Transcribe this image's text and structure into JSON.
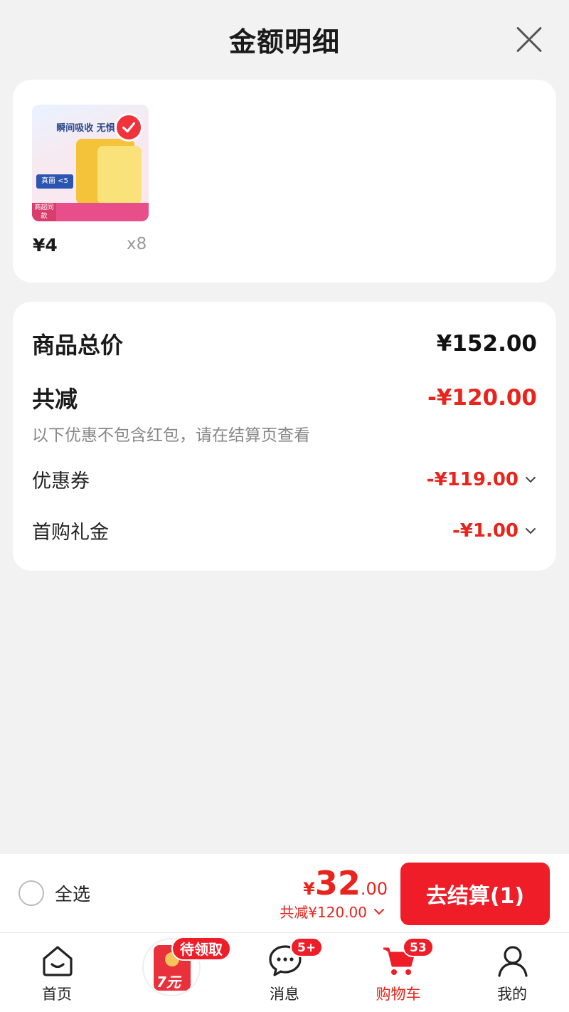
{
  "header": {
    "title": "金额明细"
  },
  "product": {
    "thumb_headline": "瞬间吸收 无惧潮",
    "thumb_tag": "真菌 <5",
    "thumb_badge": "商超同款",
    "price": "¥4",
    "quantity": "x8",
    "selected": true
  },
  "summary": {
    "total_label": "商品总价",
    "total_value": "¥152.00",
    "discount_label": "共减",
    "discount_value": "-¥120.00",
    "note": "以下优惠不包含红包，请在结算页查看",
    "items": [
      {
        "label": "优惠券",
        "value": "-¥119.00"
      },
      {
        "label": "首购礼金",
        "value": "-¥1.00"
      }
    ]
  },
  "checkout": {
    "select_all_label": "全选",
    "price_symbol": "¥",
    "price_integer": "32",
    "price_decimal": ".00",
    "saved_text": "共减¥120.00",
    "button_label": "去结算(1)"
  },
  "tabbar": {
    "promo_pill": "待领取",
    "promo_amount": "7元",
    "items": [
      {
        "label": "首页",
        "icon": "home-icon",
        "badge": ""
      },
      {
        "label": "消息",
        "icon": "message-icon",
        "badge": "5+"
      },
      {
        "label": "购物车",
        "icon": "cart-icon",
        "badge": "53",
        "active": true
      },
      {
        "label": "我的",
        "icon": "profile-icon",
        "badge": ""
      }
    ]
  },
  "colors": {
    "accent": "#ee1d27",
    "discount": "#e8241d",
    "background": "#f2f2f2"
  }
}
